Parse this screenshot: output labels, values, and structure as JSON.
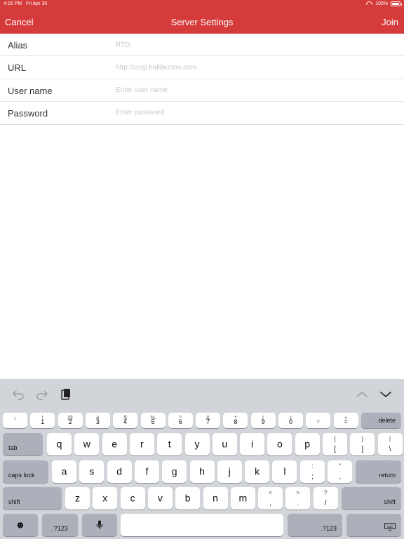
{
  "status_bar": {
    "time": "4:15 PM",
    "date": "Fri Apr 30",
    "battery": "100%"
  },
  "header": {
    "cancel_label": "Cancel",
    "title": "Server Settings",
    "join_label": "Join",
    "color": "#d63b3b"
  },
  "form": {
    "alias": {
      "label": "Alias",
      "placeholder": "RTO"
    },
    "url": {
      "label": "URL",
      "placeholder": "http://corp.halliburton.com"
    },
    "username": {
      "label": "User name",
      "placeholder": "Enter user name"
    },
    "password": {
      "label": "Password",
      "placeholder": "Enter password"
    }
  },
  "keyboard": {
    "number_row": [
      {
        "up": "~",
        "down": "`"
      },
      {
        "up": "!",
        "down": "1"
      },
      {
        "up": "@",
        "down": "2"
      },
      {
        "up": "#",
        "down": "3"
      },
      {
        "up": "$",
        "down": "4"
      },
      {
        "up": "%",
        "down": "5"
      },
      {
        "up": "^",
        "down": "6"
      },
      {
        "up": "&",
        "down": "7"
      },
      {
        "up": "*",
        "down": "8"
      },
      {
        "up": "(",
        "down": "9"
      },
      {
        "up": ")",
        "down": "0"
      },
      {
        "up": "_",
        "down": "-"
      },
      {
        "up": "+",
        "down": "="
      }
    ],
    "delete_label": "delete",
    "tab_label": "tab",
    "row1": [
      "q",
      "w",
      "e",
      "r",
      "t",
      "y",
      "u",
      "i",
      "o",
      "p"
    ],
    "row1_sym": [
      {
        "up": "{",
        "down": "["
      },
      {
        "up": "}",
        "down": "]"
      },
      {
        "up": "|",
        "down": "\\"
      }
    ],
    "caps_label": "caps lock",
    "row2": [
      "a",
      "s",
      "d",
      "f",
      "g",
      "h",
      "j",
      "k",
      "l"
    ],
    "row2_sym": [
      {
        "up": ":",
        "down": ";"
      },
      {
        "up": "\"",
        "down": ","
      }
    ],
    "return_label": "return",
    "shift_label": "shift",
    "row3": [
      "z",
      "x",
      "c",
      "v",
      "b",
      "n",
      "m"
    ],
    "row3_sym": [
      {
        "up": "<",
        "down": ","
      },
      {
        "up": ">",
        "down": "."
      },
      {
        "up": "?",
        "down": "/"
      }
    ],
    "numbers_label": ".?123",
    "emoji_glyph": "☻"
  }
}
